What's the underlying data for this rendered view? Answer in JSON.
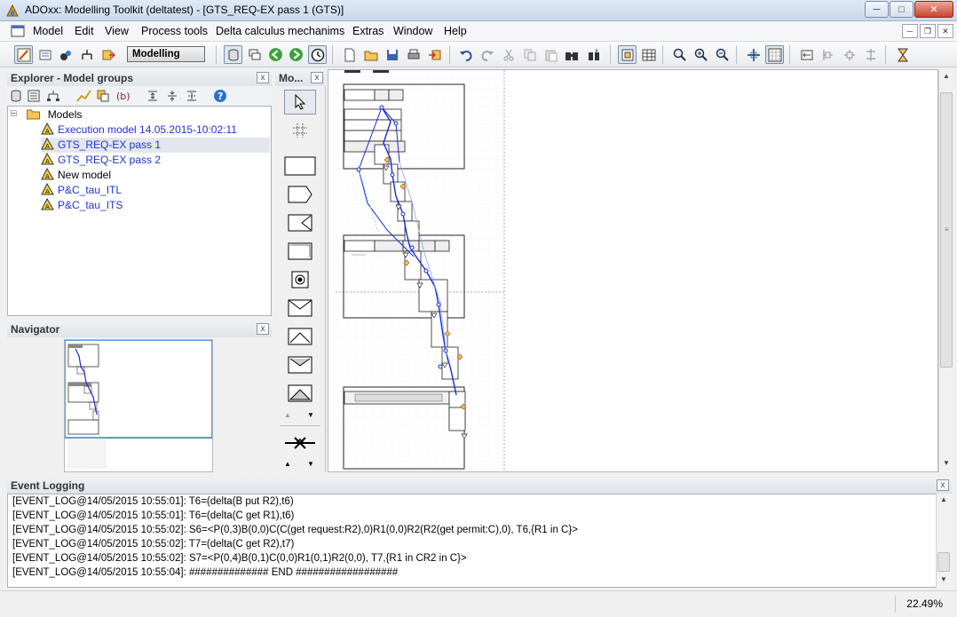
{
  "window": {
    "title": "ADOxx: Modelling Toolkit (deltatest) - [GTS_REQ-EX pass 1 (GTS)]",
    "minimize": "─",
    "maximize": "□",
    "close": "✕"
  },
  "menu": {
    "items": [
      "Model",
      "Edit",
      "View",
      "Process tools",
      "Delta calculus mechanims",
      "Extras",
      "Window",
      "Help"
    ]
  },
  "toolbar": {
    "mode": "Modelling"
  },
  "explorer": {
    "title": "Explorer - Model groups",
    "close": "x",
    "root": "Models",
    "models": [
      {
        "label": "Execution model 14.05.2015-10:02:11",
        "linked": true
      },
      {
        "label": "GTS_REQ-EX pass 1",
        "linked": true,
        "selected": true
      },
      {
        "label": "GTS_REQ-EX pass 2",
        "linked": true
      },
      {
        "label": "New model",
        "linked": false
      },
      {
        "label": "P&C_tau_ITL",
        "linked": true
      },
      {
        "label": "P&C_tau_ITS",
        "linked": true
      }
    ]
  },
  "navigator": {
    "title": "Navigator",
    "close": "x"
  },
  "palette": {
    "title": "Mo...",
    "close": "x"
  },
  "event_log": {
    "title": "Event Logging",
    "close": "x",
    "lines": [
      "[EVENT_LOG@14/05/2015 10:55:01]: T6=(delta(B put R2),t6)",
      "[EVENT_LOG@14/05/2015 10:55:01]: T6=(delta(C get R1),t6)",
      "[EVENT_LOG@14/05/2015 10:55:02]: S6=<P(0,3)B(0,0)C(C(get request:R2),0)R1(0,0)R2(R2(get permit:C),0), T6,{R1 in C}>",
      "[EVENT_LOG@14/05/2015 10:55:02]: T7=(delta(C get R2),t7)",
      "[EVENT_LOG@14/05/2015 10:55:02]: S7=<P(0,4)B(0,1)C(0,0)R1(0,1)R2(0,0), T7,{R1 in CR2 in C}>",
      "[EVENT_LOG@14/05/2015 10:55:04]: ############## END ##################"
    ]
  },
  "status": {
    "zoom": "22.49%"
  },
  "colors": {
    "link": "#1e33cc",
    "flow": "#1a2bd0"
  }
}
